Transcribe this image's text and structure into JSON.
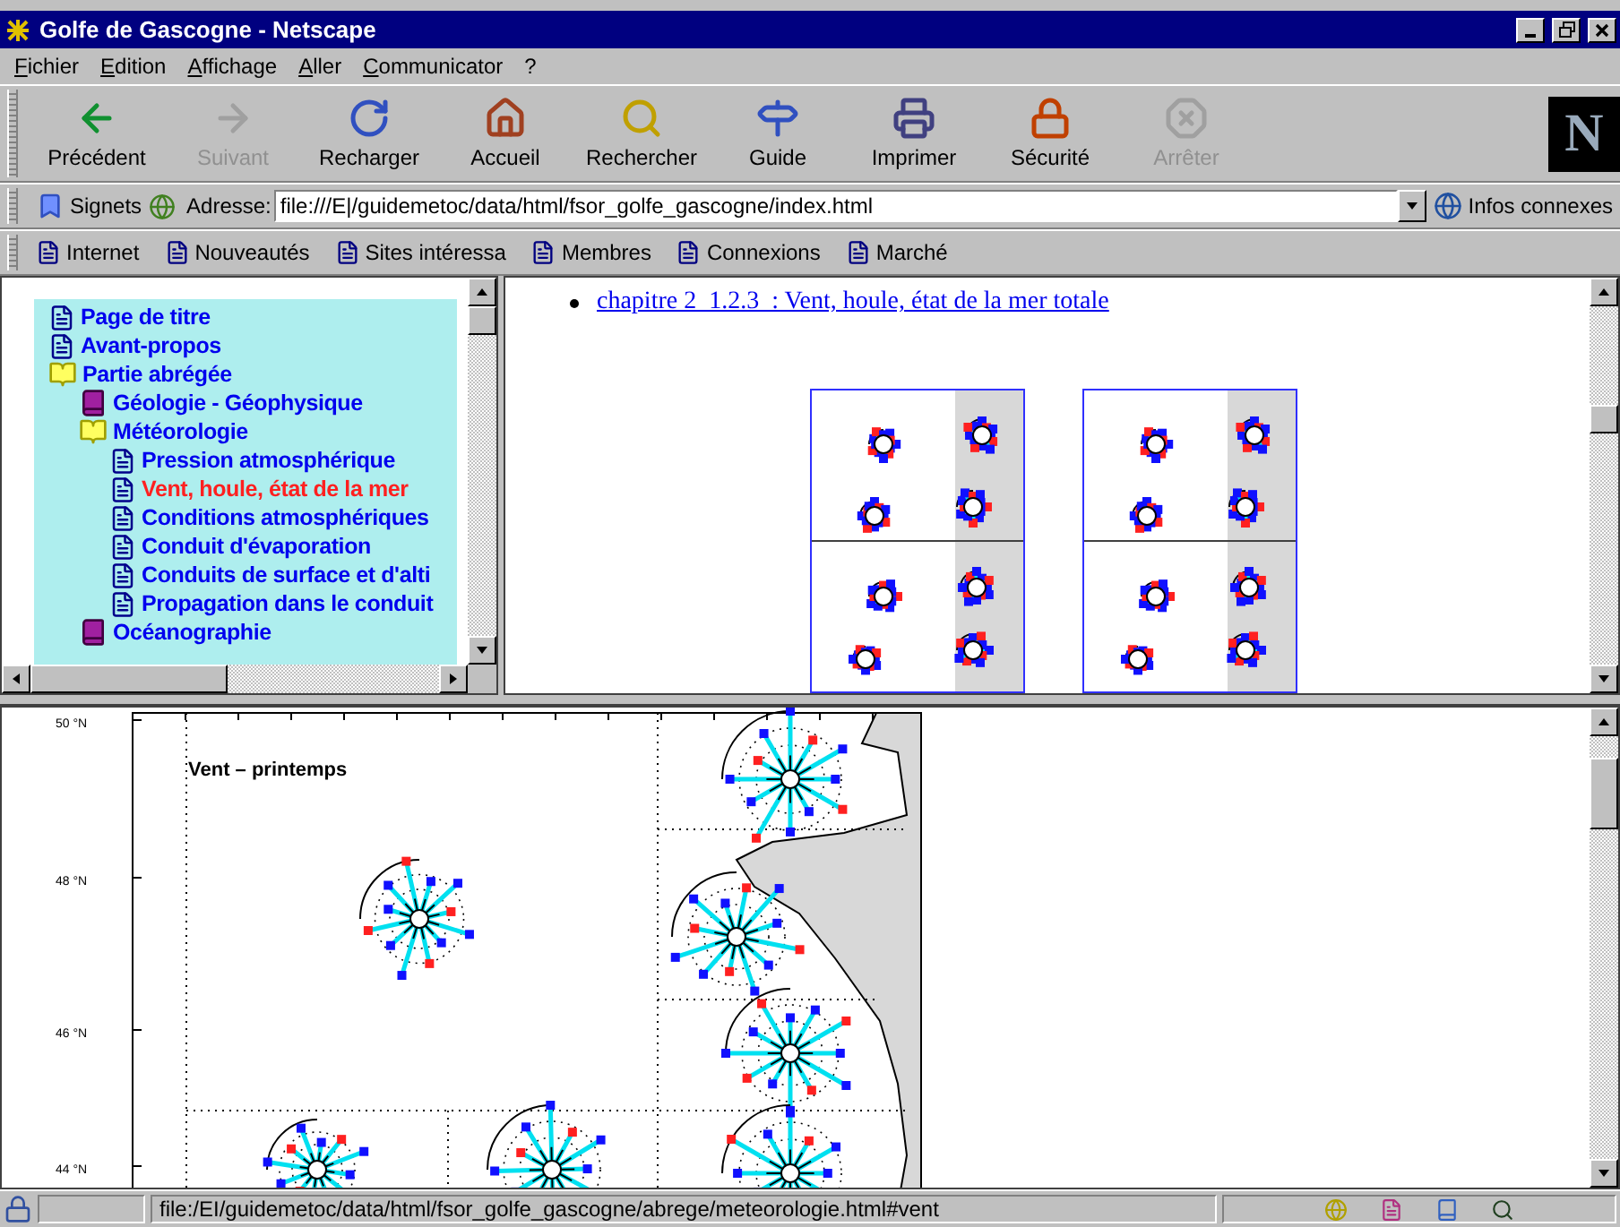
{
  "window": {
    "title": "Golfe de Gascogne - Netscape"
  },
  "menu": [
    "Fichier",
    "Edition",
    "Affichage",
    "Aller",
    "Communicator",
    "?"
  ],
  "nav_toolbar": [
    {
      "label": "Précédent",
      "disabled": false
    },
    {
      "label": "Suivant",
      "disabled": true
    },
    {
      "label": "Recharger",
      "disabled": false
    },
    {
      "label": "Accueil",
      "disabled": false
    },
    {
      "label": "Rechercher",
      "disabled": false
    },
    {
      "label": "Guide",
      "disabled": false
    },
    {
      "label": "Imprimer",
      "disabled": false
    },
    {
      "label": "Sécurité",
      "disabled": false
    },
    {
      "label": "Arrêter",
      "disabled": true
    }
  ],
  "brand_logo": "N",
  "location_bar": {
    "bookmarks": "Signets",
    "label": "Adresse:",
    "value": "file:///E|/guidemetoc/data/html/fsor_golfe_gascogne/index.html",
    "related": "Infos connexes"
  },
  "personal_toolbar": [
    "Internet",
    "Nouveautés",
    "Sites intéressa",
    "Membres",
    "Connexions",
    "Marché"
  ],
  "toc_tree": [
    {
      "label": "Page de titre",
      "kind": "page",
      "selected": false
    },
    {
      "label": "Avant-propos",
      "kind": "page",
      "selected": false
    },
    {
      "label": "Partie abrégée",
      "kind": "book",
      "expanded": true,
      "selected": false,
      "children": [
        {
          "label": "Géologie - Géophysique",
          "kind": "book",
          "expanded": false,
          "selected": false
        },
        {
          "label": "Météorologie",
          "kind": "book",
          "expanded": true,
          "selected": false,
          "children": [
            {
              "label": "Pression atmosphérique",
              "kind": "page",
              "selected": false
            },
            {
              "label": "Vent, houle, état de la mer",
              "kind": "page",
              "selected": true
            },
            {
              "label": "Conditions atmosphériques",
              "kind": "page",
              "selected": false
            },
            {
              "label": "Conduit d'évaporation",
              "kind": "page",
              "selected": false
            },
            {
              "label": "Conduits de surface et d'alti",
              "kind": "page",
              "selected": false
            },
            {
              "label": "Propagation dans le conduit",
              "kind": "page",
              "selected": false
            }
          ]
        },
        {
          "label": "Océanographie",
          "kind": "book",
          "expanded": false,
          "selected": false
        }
      ]
    }
  ],
  "content": {
    "link": "chapitre 2  1.2.3  : Vent, houle, état de la mer totale"
  },
  "map": {
    "title": "Vent – printemps",
    "latitudes": [
      "50 °N",
      "48 °N",
      "46 °N",
      "44 °N"
    ]
  },
  "status_bar": {
    "text": "file:/EI/guidemetoc/data/html/fsor_golfe_gascogne/abrege/meteorologie.html#vent"
  }
}
